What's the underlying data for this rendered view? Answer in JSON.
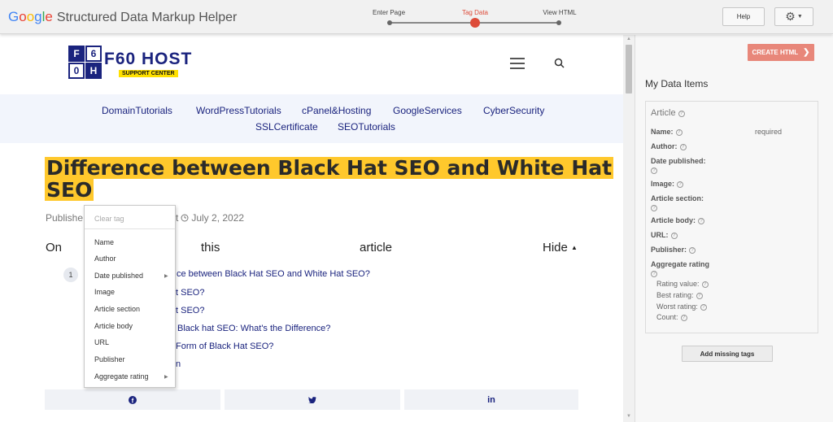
{
  "header": {
    "logo_g1": "G",
    "logo_o1": "o",
    "logo_o2": "o",
    "logo_g2": "g",
    "logo_l": "l",
    "logo_e": "e",
    "app_name": "Structured Data Markup Helper",
    "steps": [
      {
        "label": "Enter Page"
      },
      {
        "label": "Tag Data"
      },
      {
        "label": "View HTML"
      }
    ],
    "help_label": "Help",
    "gear_icon": "gear-icon"
  },
  "site": {
    "logo_cells": [
      "F",
      "6",
      "0",
      "H"
    ],
    "name": "F60 HOST",
    "tagline": "SUPPORT CENTER",
    "nav": [
      "DomainTutorials",
      "WordPressTutorials",
      "cPanel&Hosting",
      "GoogleServices",
      "CyberSecurity",
      "SSLCertificate",
      "SEOTutorials"
    ],
    "title_line1": "Difference between Black Hat SEO and White Hat",
    "title_line2": "SEO",
    "meta_published": "Publishe",
    "meta_t": "t",
    "meta_date": "July 2, 2022",
    "toc_words": [
      "On",
      "this",
      "article",
      "Hide"
    ],
    "toc_num": "1",
    "toc_items": [
      "ce between Black Hat SEO and White Hat SEO?",
      "t SEO?",
      "t SEO?",
      "Black hat SEO: What's the Difference?",
      "Form of Black Hat SEO?",
      "n"
    ],
    "share": [
      "facebook-icon",
      "twitter-icon",
      "linkedin-icon"
    ]
  },
  "context_menu": {
    "clear": "Clear tag",
    "items": [
      "Name",
      "Author",
      "Date published",
      "Image",
      "Article section",
      "Article body",
      "URL",
      "Publisher",
      "Aggregate rating"
    ]
  },
  "panel": {
    "create_label": "CREATE HTML",
    "title": "My Data Items",
    "article_label": "Article",
    "required_label": "required",
    "fields": [
      "Name:",
      "Author:",
      "Date published:",
      "Image:",
      "Article section:",
      "Article body:",
      "URL:",
      "Publisher:",
      "Aggregate rating"
    ],
    "subfields": [
      "Rating value:",
      "Best rating:",
      "Worst rating:",
      "Count:"
    ],
    "missing_label": "Add missing tags"
  },
  "colors": {
    "accent": "#dd4b39",
    "highlight": "#ffc82c",
    "brand": "#1a237e"
  }
}
